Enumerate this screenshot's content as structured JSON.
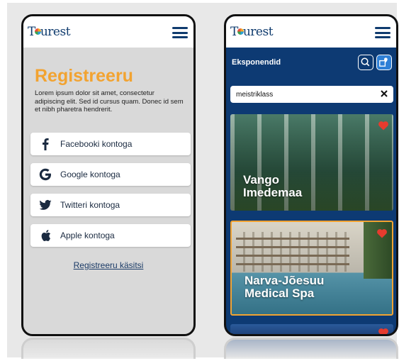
{
  "left_screen": {
    "logo": {
      "prefix": "T",
      "suffix": "urest"
    },
    "title": "Registreeru",
    "description": "Lorem ipsum dolor sit amet, consectetur adipiscing elit. Sed id cursus quam. Donec id sem et nibh pharetra hendrerit.",
    "buttons": [
      {
        "label": "Facebooki kontoga",
        "icon": "facebook-icon"
      },
      {
        "label": "Google kontoga",
        "icon": "google-icon"
      },
      {
        "label": "Twitteri kontoga",
        "icon": "twitter-icon"
      },
      {
        "label": "Apple kontoga",
        "icon": "apple-icon"
      }
    ],
    "manual_link": "Registreeru käsitsi"
  },
  "right_screen": {
    "logo": {
      "prefix": "T",
      "suffix": "urest"
    },
    "section_title": "Eksponendid",
    "search": {
      "value": "meistriklass"
    },
    "cards": [
      {
        "title_line1": "Vango",
        "title_line2": "Imedemaa",
        "favorited": true
      },
      {
        "title_line1": "Narva-Jõesuu",
        "title_line2": "Medical Spa",
        "favorited": true
      }
    ]
  },
  "colors": {
    "accent_orange": "#f2a331",
    "brand_navy": "#0d3a73",
    "heart_red": "#e63b2e"
  }
}
